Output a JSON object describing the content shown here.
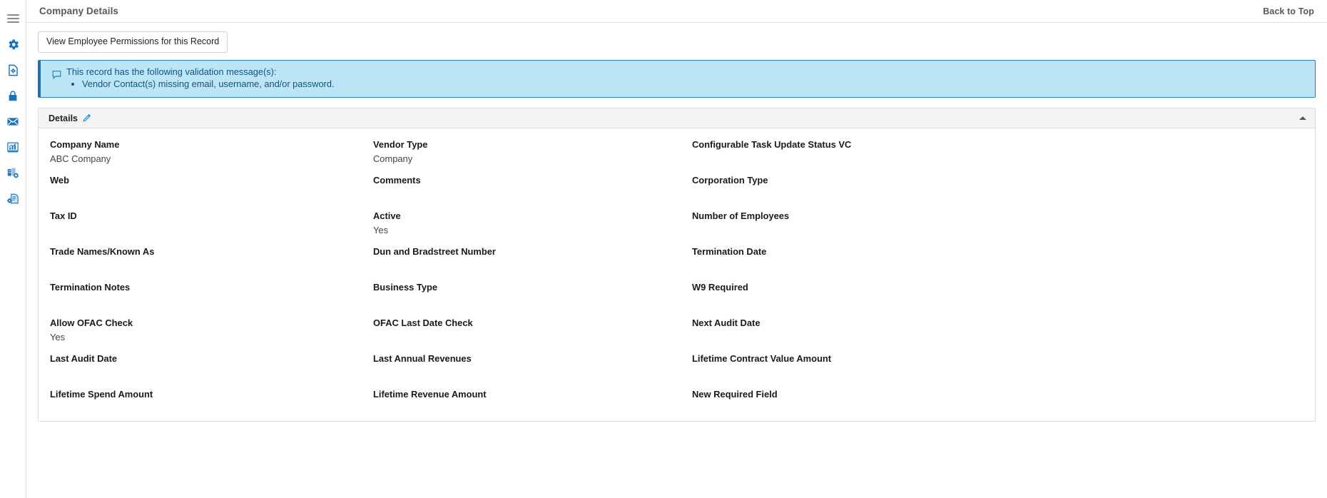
{
  "rail": {
    "items": [
      {
        "name": "menu-toggle",
        "icon": "hamburger-icon",
        "label": "Menu"
      },
      {
        "name": "settings",
        "icon": "gear-icon",
        "label": "Settings"
      },
      {
        "name": "document-settings",
        "icon": "document-gear-icon",
        "label": "Document Settings"
      },
      {
        "name": "security",
        "icon": "lock-icon",
        "label": "Security"
      },
      {
        "name": "messages",
        "icon": "envelope-icon",
        "label": "Messages"
      },
      {
        "name": "reports",
        "icon": "chart-bar-icon",
        "label": "Reports"
      },
      {
        "name": "add-company",
        "icon": "building-plus-icon",
        "label": "Add Company"
      },
      {
        "name": "document-config",
        "icon": "document-cog-icon",
        "label": "Document Configuration"
      }
    ]
  },
  "header": {
    "title": "Company Details",
    "back_to_top": "Back to Top"
  },
  "toolbar": {
    "view_permissions_label": "View Employee Permissions for this Record"
  },
  "banner": {
    "icon": "comment-icon",
    "lead": "This record has the following validation message(s):",
    "messages": [
      "Vendor Contact(s) missing email, username, and/or password."
    ],
    "background_color": "#bde5f8",
    "border_color": "#2b7bb9",
    "text_color": "#12537e"
  },
  "details_panel": {
    "title": "Details",
    "edit_icon": "pencil-icon",
    "collapse_icon": "caret-up-icon",
    "rows": [
      [
        {
          "label": "Company Name",
          "value": "ABC Company"
        },
        {
          "label": "Vendor Type",
          "value": "Company"
        },
        {
          "label": "Configurable Task Update Status VC",
          "value": ""
        }
      ],
      [
        {
          "label": "Web",
          "value": ""
        },
        {
          "label": "Comments",
          "value": ""
        },
        {
          "label": "Corporation Type",
          "value": ""
        }
      ],
      [
        {
          "label": "Tax ID",
          "value": ""
        },
        {
          "label": "Active",
          "value": "Yes"
        },
        {
          "label": "Number of Employees",
          "value": ""
        }
      ],
      [
        {
          "label": "Trade Names/Known As",
          "value": ""
        },
        {
          "label": "Dun and Bradstreet Number",
          "value": ""
        },
        {
          "label": "Termination Date",
          "value": ""
        }
      ],
      [
        {
          "label": "Termination Notes",
          "value": ""
        },
        {
          "label": "Business Type",
          "value": ""
        },
        {
          "label": "W9 Required",
          "value": ""
        }
      ],
      [
        {
          "label": "Allow OFAC Check",
          "value": "Yes"
        },
        {
          "label": "OFAC Last Date Check",
          "value": ""
        },
        {
          "label": "Next Audit Date",
          "value": ""
        }
      ],
      [
        {
          "label": "Last Audit Date",
          "value": ""
        },
        {
          "label": "Last Annual Revenues",
          "value": ""
        },
        {
          "label": "Lifetime Contract Value Amount",
          "value": ""
        }
      ],
      [
        {
          "label": "Lifetime Spend Amount",
          "value": ""
        },
        {
          "label": "Lifetime Revenue Amount",
          "value": ""
        },
        {
          "label": "New Required Field",
          "value": ""
        }
      ]
    ]
  },
  "colors": {
    "accent_blue": "#1a72b8",
    "panel_header": "#f4f4f4",
    "rail_border": "#e3e3e3"
  }
}
